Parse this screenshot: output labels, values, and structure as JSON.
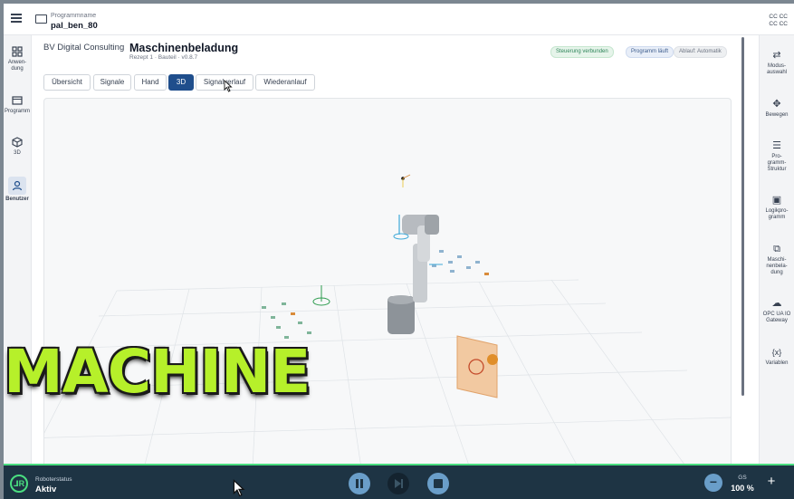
{
  "header": {
    "program_label": "Programmname",
    "program_name": "pal_ben_80",
    "cc_line1": "CC CC",
    "cc_line2": "CC CC"
  },
  "left_nav": [
    {
      "label": "Anwen-\ndung",
      "icon": "grid-icon"
    },
    {
      "label": "Programm",
      "icon": "program-icon"
    },
    {
      "label": "3D",
      "icon": "cube-icon"
    },
    {
      "label": "Benutzer",
      "icon": "user-icon",
      "active": true
    }
  ],
  "right_nav": [
    {
      "label": "Modus-\nauswahl",
      "icon": "mode-icon"
    },
    {
      "label": "Bewegen",
      "icon": "move-icon"
    },
    {
      "label": "Pro-\ngramm-\nStruktur",
      "icon": "list-icon"
    },
    {
      "label": "Logikpro-\ngramm",
      "icon": "logic-icon"
    },
    {
      "label": "Maschi-\nnenbela-\ndung",
      "icon": "machine-icon"
    },
    {
      "label": "OPC UA IO\nGateway",
      "icon": "cloud-icon"
    },
    {
      "label": "Variablen",
      "icon": "variables-icon"
    }
  ],
  "content": {
    "company": "BV Digital Consulting",
    "title": "Maschinenbeladung",
    "subtitle": "Rezept 1 · Bauteil · v0.8.7",
    "badges": [
      "Steuerung verbunden",
      "Programm läuft",
      "Ablauf: Automatik"
    ],
    "tabs": [
      "Übersicht",
      "Signale",
      "Hand",
      "3D",
      "Signalverlauf",
      "Wiederanlauf"
    ],
    "active_tab": "3D"
  },
  "overlay_text": "MACHINE",
  "bottom_bar": {
    "status_label": "Roboterstatus",
    "status_value": "Aktiv",
    "speed_label": "GS",
    "speed_value": "100 %"
  },
  "colors": {
    "accent": "#1f4e8c",
    "status_green": "#4ade80",
    "bottom_bar": "#1e3444",
    "overlay": "#b6f02a"
  }
}
